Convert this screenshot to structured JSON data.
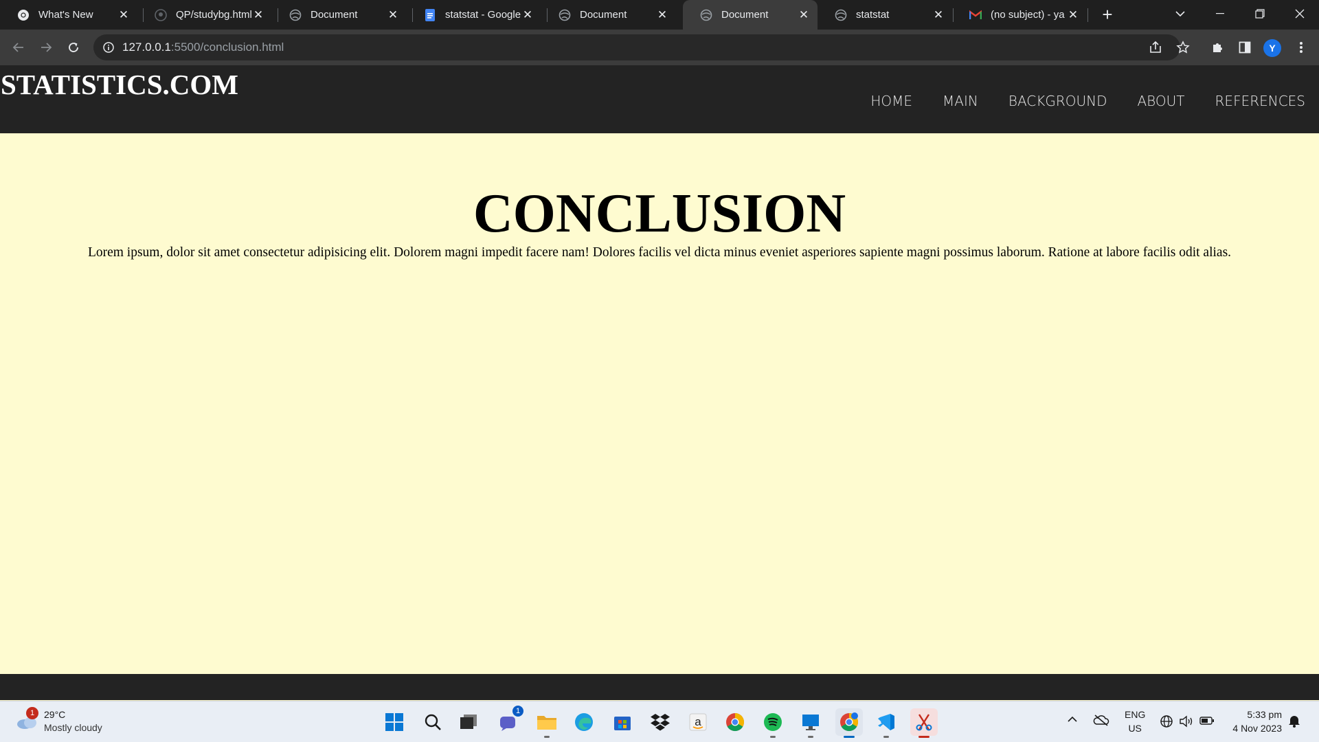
{
  "browser": {
    "tabs": [
      {
        "title": "What's New",
        "icon": "chrome-logo-icon",
        "active": false
      },
      {
        "title": "QP/studybg.html",
        "icon": "github-icon",
        "active": false
      },
      {
        "title": "Document",
        "icon": "globe-icon",
        "active": false
      },
      {
        "title": "statstat - Google",
        "icon": "google-docs-icon",
        "active": false
      },
      {
        "title": "Document",
        "icon": "globe-icon",
        "active": false
      },
      {
        "title": "Document",
        "icon": "globe-icon",
        "active": true
      },
      {
        "title": "statstat",
        "icon": "globe-icon",
        "active": false
      },
      {
        "title": "(no subject) - ya",
        "icon": "gmail-icon",
        "active": false
      }
    ],
    "url_host": "127.0.0.1",
    "url_path": ":5500/conclusion.html",
    "profile_initial": "Y"
  },
  "site": {
    "logo": "STATISTICS.COM",
    "nav": [
      "HOME",
      "MAIN",
      "BACKGROUND",
      "ABOUT",
      "REFERENCES"
    ],
    "heading": "CONCLUSION",
    "paragraph": "Lorem ipsum, dolor sit amet consectetur adipisicing elit. Dolorem magni impedit facere nam! Dolores facilis vel dicta minus eveniet asperiores sapiente magni possimus laborum. Ratione at labore facilis odit alias."
  },
  "taskbar": {
    "weather_temp": "29°C",
    "weather_desc": "Mostly cloudy",
    "weather_badge": "1",
    "chat_badge": "1",
    "lang_line1": "ENG",
    "lang_line2": "US",
    "time": "5:33 pm",
    "date": "4 Nov 2023"
  },
  "colors": {
    "page_bg": "#fefbd0",
    "header_bg": "#232323",
    "browser_frame": "#1f1f1f",
    "active_tab": "#3c3c3c"
  }
}
